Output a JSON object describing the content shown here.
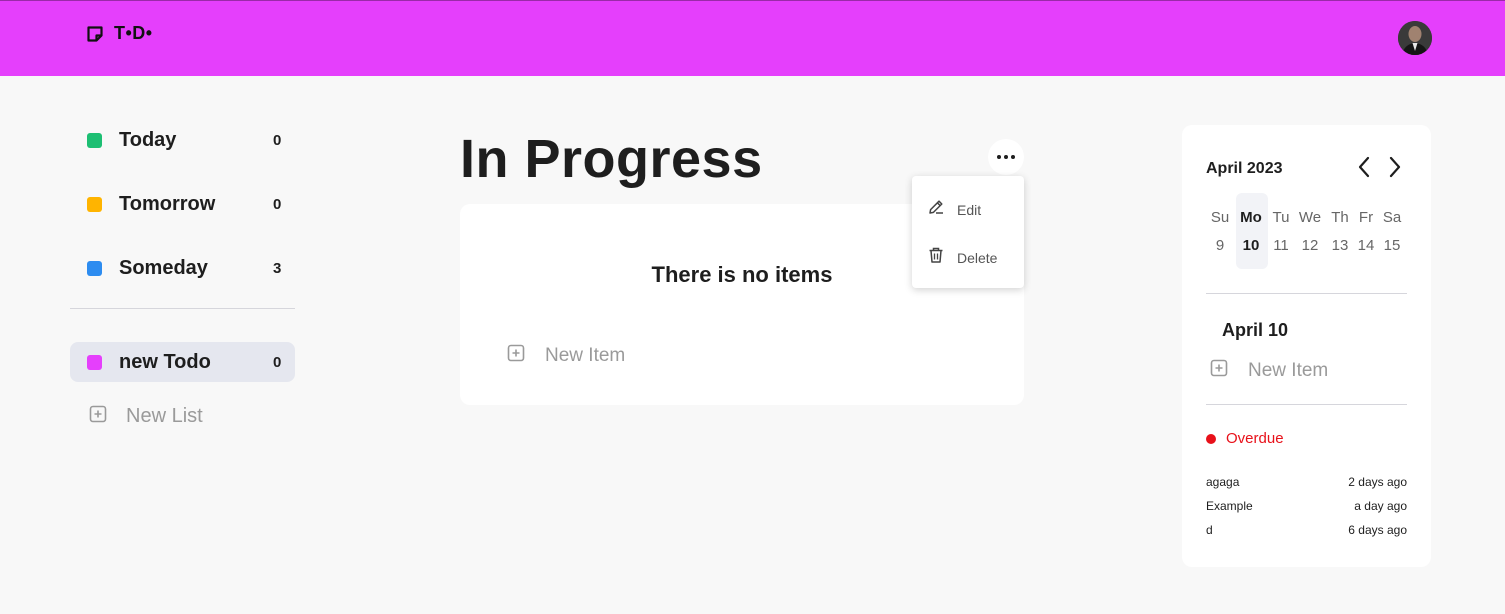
{
  "header": {
    "logo_text": "T•D•",
    "brand_color": "#e53ffc",
    "logo_icon": "sticky-note-icon",
    "avatar_icon": "user-avatar"
  },
  "sidebar": {
    "items": [
      {
        "label": "Today",
        "count": "0",
        "color": "#1dbf73"
      },
      {
        "label": "Tomorrow",
        "count": "0",
        "color": "#ffb400"
      },
      {
        "label": "Someday",
        "count": "3",
        "color": "#2d8cf0"
      }
    ],
    "lists": [
      {
        "label": "new Todo",
        "count": "0",
        "color": "#e53ffc",
        "active": true
      }
    ],
    "new_list_label": "New List"
  },
  "main": {
    "title": "In Progress",
    "empty_text": "There is no items",
    "new_item_label": "New Item"
  },
  "menu": {
    "edit_label": "Edit",
    "delete_label": "Delete"
  },
  "calendar": {
    "month_label": "April 2023",
    "weekdays": [
      "Su",
      "Mo",
      "Tu",
      "We",
      "Th",
      "Fr",
      "Sa"
    ],
    "days": [
      "9",
      "10",
      "11",
      "12",
      "13",
      "14",
      "15"
    ],
    "selected_index": 1,
    "selected_date_label": "April 10",
    "new_item_label": "New Item",
    "overdue_label": "Overdue",
    "overdue_color": "#e8111a",
    "overdue_items": [
      {
        "name": "agaga",
        "ago": "2 days ago"
      },
      {
        "name": "Example",
        "ago": "a day ago"
      },
      {
        "name": "d",
        "ago": "6 days ago"
      }
    ]
  }
}
